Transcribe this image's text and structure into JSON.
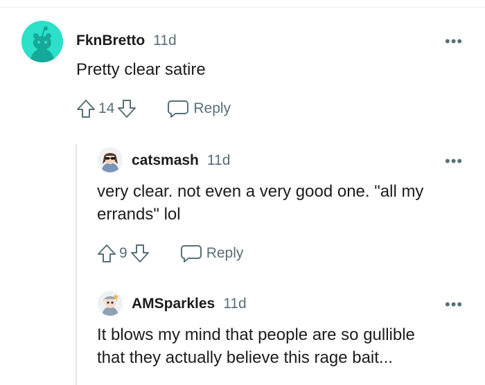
{
  "comments": [
    {
      "username": "FknBretto",
      "age": "11d",
      "body": "Pretty clear satire",
      "votes": "14",
      "reply_label": "Reply"
    },
    {
      "username": "catsmash",
      "age": "11d",
      "body_lines": [
        "very clear. not even a very good one. \"all my",
        "errands\" lol"
      ],
      "votes": "9",
      "reply_label": "Reply"
    },
    {
      "username": "AMSparkles",
      "age": "11d",
      "body_lines": [
        "It blows my mind that people are so gullible",
        "that they actually believe this rage bait..."
      ]
    }
  ],
  "more_icon": "•••",
  "colors": {
    "meta": "#576f76",
    "avatar_teal": "#2ce0c9",
    "text": "#1c1c1c"
  }
}
